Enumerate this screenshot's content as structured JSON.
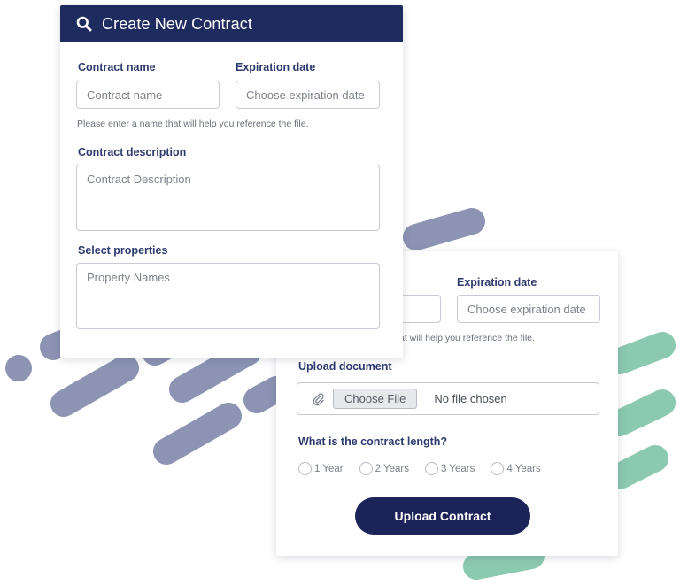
{
  "front_form": {
    "title": "Create New Contract",
    "contract_name_label": "Contract name",
    "contract_name_placeholder": "Contract name",
    "expiration_label": "Expiration date",
    "expiration_placeholder": "Choose expiration date",
    "name_hint": "Please enter a name that will help you reference the file.",
    "description_label": "Contract description",
    "description_placeholder": "Contract Description",
    "properties_label": "Select properties",
    "properties_placeholder": "Property Names"
  },
  "back_form": {
    "expiration_label": "Expiration date",
    "expiration_placeholder": "Choose expiration date",
    "name_hint_partial": "at will help you reference the file.",
    "upload_label": "Upload document",
    "choose_file_label": "Choose File",
    "no_file_text": "No file chosen",
    "length_question": "What is the contract length?",
    "length_options": [
      "1 Year",
      "2 Years",
      "3 Years",
      "4 Years"
    ],
    "submit_label": "Upload Contract"
  },
  "icons": {
    "header": "search-icon",
    "attachment": "paperclip-icon"
  },
  "colors": {
    "header_bg": "#1e2b5e",
    "button_bg": "#1b2358",
    "decor_slate": "#8c93b3",
    "decor_green": "#8cc9b1",
    "label_text": "#2c3a6e"
  }
}
